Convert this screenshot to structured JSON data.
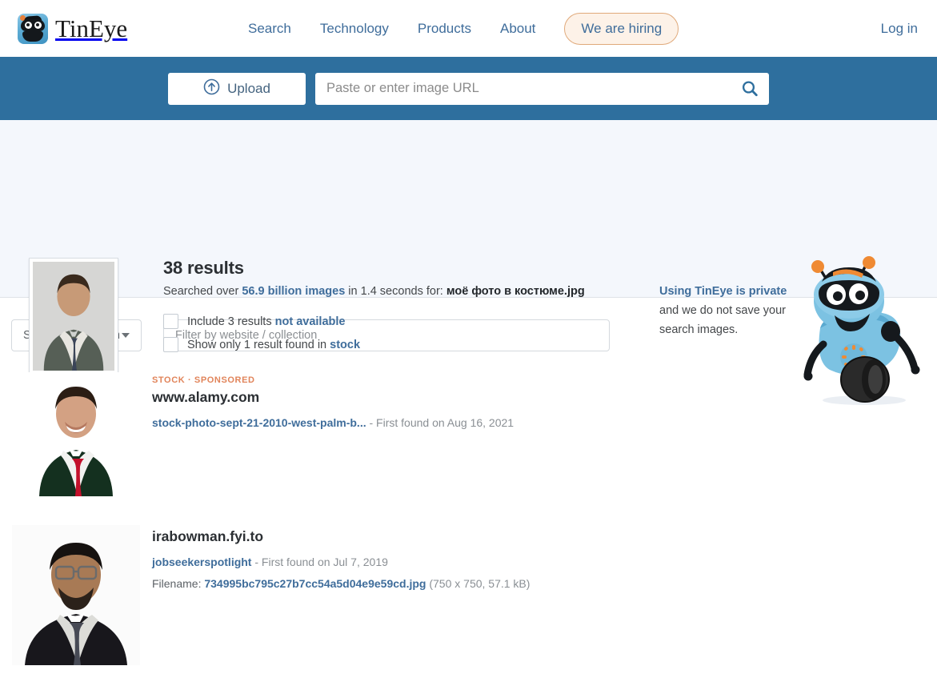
{
  "header": {
    "brand": "TinEye",
    "nav": [
      {
        "label": "Search",
        "name": "nav-search"
      },
      {
        "label": "Technology",
        "name": "nav-technology"
      },
      {
        "label": "Products",
        "name": "nav-products"
      },
      {
        "label": "About",
        "name": "nav-about"
      }
    ],
    "hiring_label": "We are hiring",
    "login_label": "Log in"
  },
  "search": {
    "upload_label": "Upload",
    "url_placeholder": "Paste or enter image URL",
    "url_value": "",
    "upload_icon": "upload-circle-icon",
    "search_icon": "search-icon"
  },
  "results_header": {
    "count_label": "38 results",
    "searched_prefix": "Searched over ",
    "index_size": "56.9 billion images",
    "searched_middle": " in 1.4 seconds for: ",
    "query_filename": "моё фото в костюме.jpg",
    "checkbox_not_available": {
      "prefix": "Include 3 results ",
      "link": "not available"
    },
    "checkbox_stock": {
      "prefix": "Show only 1 result found in ",
      "link": "stock"
    },
    "privacy_link": "Using TinEye is private",
    "privacy_text": " and we do not save your search images."
  },
  "filters": {
    "sort_value": "Sort by best match",
    "filter_placeholder": "Filter by website / collection",
    "filter_value": ""
  },
  "results": [
    {
      "tags": "STOCK · SPONSORED",
      "domain": "www.alamy.com",
      "link_text": "stock-photo-sept-21-2010-west-palm-b...",
      "found_text": " - First found on Aug 16, 2021",
      "has_filename": false
    },
    {
      "tags": "",
      "domain": "irabowman.fyi.to",
      "link_text": "jobseekerspotlight",
      "found_text": " - First found on Jul 7, 2019",
      "has_filename": true,
      "filename_label": "Filename: ",
      "filename": "734995bc795c27b7cc54a5d04e9e59cd.jpg",
      "dimensions": " (750 x 750, 57.1 kB)"
    }
  ],
  "colors": {
    "band_blue": "#2e6f9e",
    "link_blue": "#3f6d9b",
    "accent_orange": "#b8703a",
    "tag_orange": "#e1845a",
    "panel_bg": "#f4f7fc"
  }
}
